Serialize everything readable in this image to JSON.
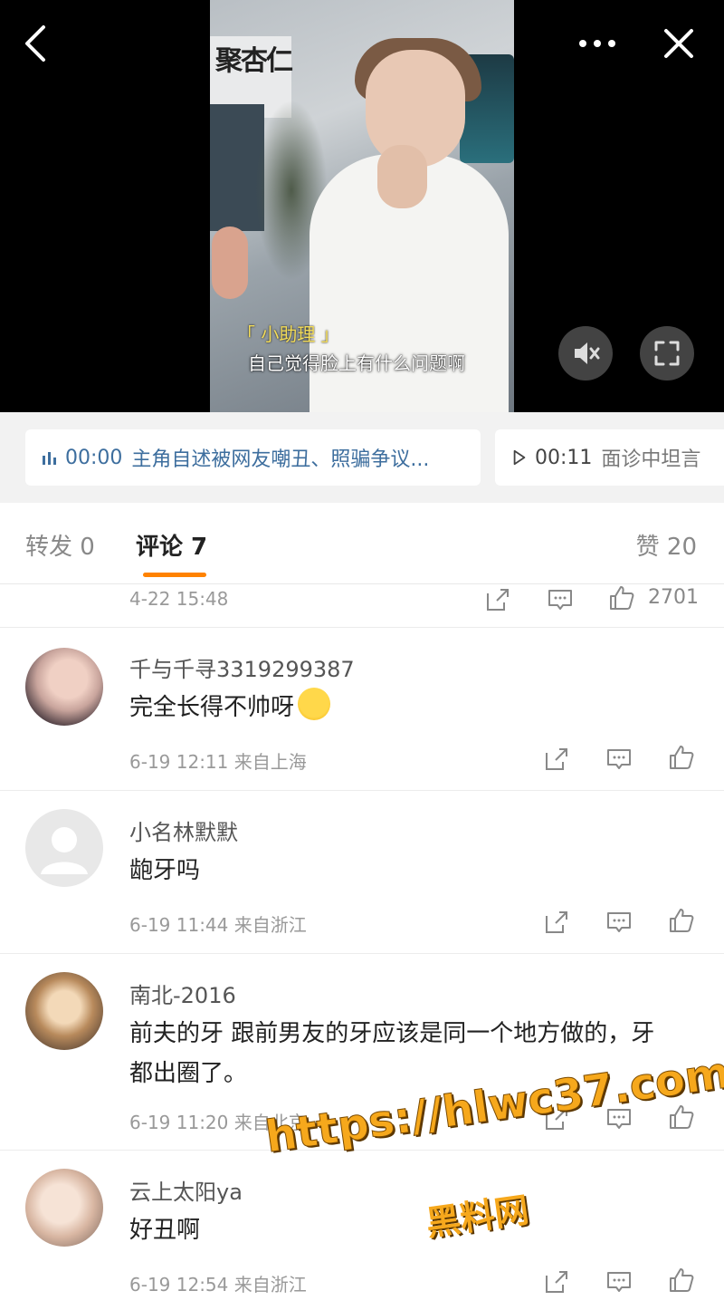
{
  "video": {
    "caption_speaker": "「 小助理 」",
    "caption_text": "自己觉得脸上有什么问题啊",
    "sign_text": "聚杏仁"
  },
  "icons": {
    "back": "chevron-left-icon",
    "more": "more-dots-icon",
    "close": "close-x-icon",
    "mute": "speaker-muted-icon",
    "fullscreen": "fullscreen-icon",
    "share": "share-icon",
    "comment": "comment-icon",
    "like": "thumbs-up-icon"
  },
  "chapters": [
    {
      "time": "00:00",
      "title": "主角自述被网友嘲丑、照骗争议..."
    },
    {
      "time": "00:11",
      "title": "面诊中坦言"
    }
  ],
  "tabs": {
    "repost": "转发 0",
    "comment": "评论 7",
    "like": "赞 20"
  },
  "prev_comment": {
    "time": "4-22 15:48",
    "likes": "2701"
  },
  "comments": [
    {
      "user": "千与千寻3319299387",
      "text": "完全长得不帅呀",
      "meta": "6-19 12:11  来自上海"
    },
    {
      "user": "小名林默默",
      "text": "龅牙吗",
      "meta": "6-19 11:44  来自浙江"
    },
    {
      "user": "南北-2016",
      "text": "前夫的牙 跟前男友的牙应该是同一个地方做的，牙都出圈了。",
      "meta": "6-19 11:20  来自北京"
    },
    {
      "user": "云上太阳ya",
      "text": "好丑啊",
      "meta": "6-19 12:54  来自浙江"
    }
  ],
  "watermark": {
    "url": "https://hlwc37.com",
    "name": "黑料网"
  },
  "colors": {
    "accent": "#ff8200",
    "link": "#3d6e9e"
  }
}
